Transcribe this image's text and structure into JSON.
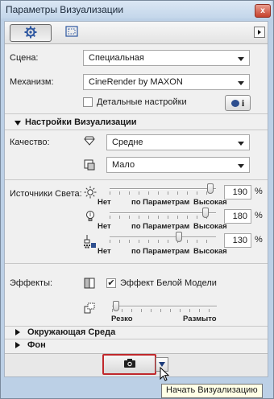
{
  "window": {
    "title": "Параметры Визуализации",
    "close_label": "x"
  },
  "scene": {
    "label": "Сцена:",
    "value": "Специальная"
  },
  "engine": {
    "label": "Механизм:",
    "value": "CineRender by MAXON"
  },
  "detail_settings": {
    "label": "Детальные настройки",
    "checked": false,
    "info_label": "i"
  },
  "render_settings": {
    "header": "Настройки Визуализации",
    "quality_label": "Качество:",
    "quality_value": "Средне",
    "quality2_value": "Мало"
  },
  "lights": {
    "label": "Источники Света:",
    "unit": "%",
    "scale_labels": [
      "Нет",
      "по Параметрам",
      "Высокая"
    ],
    "rows": [
      {
        "icon": "sun-icon",
        "value": "190",
        "level": 0.95
      },
      {
        "icon": "bulb-icon",
        "value": "180",
        "level": 0.9
      },
      {
        "icon": "lamp-icon",
        "value": "130",
        "level": 0.65
      }
    ]
  },
  "effects": {
    "label": "Эффекты:",
    "white_model_label": "Эффект Белой Модели",
    "white_model_checked": true,
    "blur_scale": [
      "Резко",
      "Размыто"
    ],
    "blur_level": 0.0
  },
  "sections": {
    "environment": "Окружающая Среда",
    "background": "Фон"
  },
  "tooltip": "Начать Визуализацию"
}
